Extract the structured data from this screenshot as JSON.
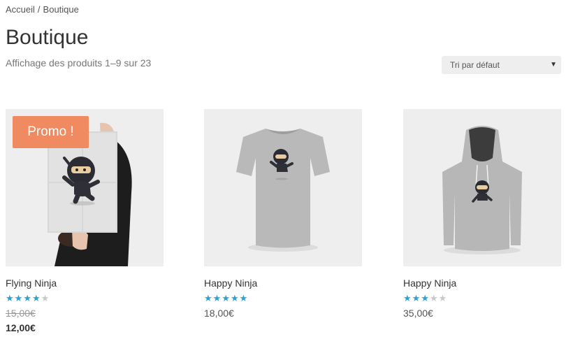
{
  "breadcrumb": {
    "home": "Accueil",
    "separator": "/",
    "current": "Boutique"
  },
  "page": {
    "title": "Boutique",
    "result_count": "Affichage des produits 1–9 sur 23",
    "orderby": {
      "selected": "Tri par défaut",
      "caret": "▼"
    }
  },
  "colors": {
    "accent_star": "#2e9fd6",
    "badge": "#f08a60",
    "thumb_bg": "#eeeeee"
  },
  "products": [
    {
      "name": "Flying Ninja",
      "badge": "Promo !",
      "rating": 4,
      "rating_max": 5,
      "price_old": "15,00€",
      "price": "12,00€",
      "image_icon": "ninja-poster-icon"
    },
    {
      "name": "Happy Ninja",
      "rating": 5,
      "rating_max": 5,
      "price": "18,00€",
      "image_icon": "ninja-tshirt-icon"
    },
    {
      "name": "Happy Ninja",
      "rating": 3,
      "rating_max": 5,
      "price": "35,00€",
      "image_icon": "ninja-hoodie-icon"
    }
  ]
}
